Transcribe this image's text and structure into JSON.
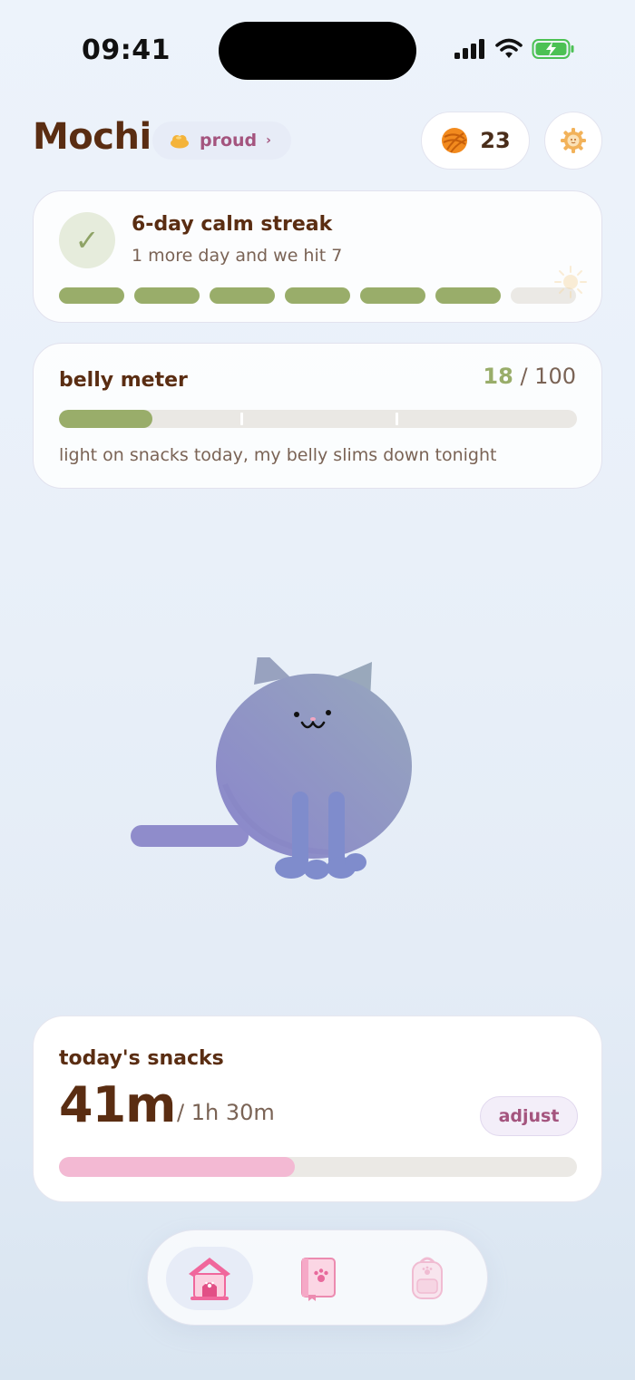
{
  "status_bar": {
    "time": "09:41"
  },
  "header": {
    "pet_name": "Mochi",
    "mood_label": "proud",
    "mood_chevron": "›",
    "coins": "23"
  },
  "streak": {
    "check_glyph": "✓",
    "title": "6-day calm streak",
    "subtitle": "1 more day and we hit 7",
    "filled_days": 6,
    "total_days": 7
  },
  "belly": {
    "title": "belly meter",
    "value": "18",
    "max": "/ 100",
    "fill_fraction": 0.18,
    "description": "light on snacks today, my belly slims down tonight"
  },
  "snacks": {
    "title": "today's snacks",
    "used": "41m",
    "limit": "/ 1h 30m",
    "adjust_label": "adjust",
    "fill_fraction": 0.456
  },
  "tabs": [
    {
      "icon": "doghouse-icon",
      "active": true
    },
    {
      "icon": "paw-book-icon",
      "active": false
    },
    {
      "icon": "backpack-icon",
      "active": false
    }
  ],
  "colors": {
    "accent_green": "#99ad6a",
    "accent_pink": "#f3b9d3",
    "brand_brown": "#5a2d12",
    "mood_pink": "#a4547e",
    "cat_purple": "#8f8fc8"
  }
}
